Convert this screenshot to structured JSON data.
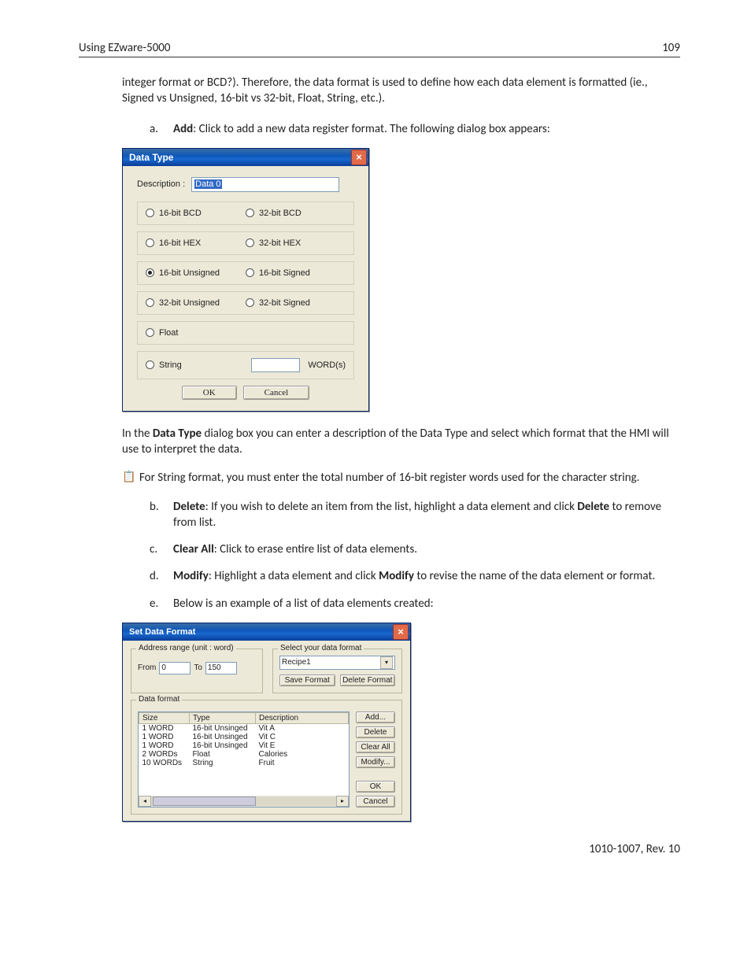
{
  "header": {
    "left": "Using EZware-5000",
    "right": "109"
  },
  "intro": "integer format or BCD?). Therefore, the data format is used to define how each data element is formatted (ie., Signed vs Unsigned, 16-bit vs 32-bit, Float, String, etc.).",
  "item_a": {
    "letter": "a.",
    "name": "Add",
    "rest": ": Click to add a new data register format. The following dialog box appears:"
  },
  "dlg1": {
    "title": "Data Type",
    "description_label": "Description :",
    "description_value": "Data 0",
    "radios": {
      "r16bcd": "16-bit BCD",
      "r32bcd": "32-bit BCD",
      "r16hex": "16-bit HEX",
      "r32hex": "32-bit HEX",
      "r16u": "16-bit Unsigned",
      "r16s": "16-bit Signed",
      "r32u": "32-bit Unsigned",
      "r32s": "32-bit Signed",
      "float": "Float",
      "string": "String",
      "words_suffix": "WORD(s)"
    },
    "ok": "OK",
    "cancel": "Cancel"
  },
  "after_dlg1_pre": "In the ",
  "after_dlg1_bold": "Data Type",
  "after_dlg1_post": " dialog box you can enter a description of the Data Type and select which format that the HMI will use to interpret the data.",
  "note": "For String format, you must enter the total number of 16-bit register words used for the character string.",
  "item_b": {
    "letter": "b.",
    "name": "Delete",
    "mid": ": If you wish to delete an item from the list, highlight a data element and click ",
    "name2": "Delete",
    "rest": " to remove from list."
  },
  "item_c": {
    "letter": "c.",
    "name": "Clear All",
    "rest": ": Click to erase entire list of data elements."
  },
  "item_d": {
    "letter": "d.",
    "name": "Modify",
    "mid": ": Highlight a data element and click ",
    "name2": "Modify",
    "rest": " to revise the name of the data element or format."
  },
  "item_e": {
    "letter": "e.",
    "rest": "Below is an example of a list of data elements created:"
  },
  "dlg2": {
    "title": "Set Data Format",
    "address_legend": "Address range (unit : word)",
    "from_label": "From",
    "from_value": "0",
    "to_label": "To",
    "to_value": "150",
    "select_legend": "Select your data format",
    "combo_value": "Recipe1",
    "save_format": "Save Format",
    "delete_format": "Delete Format",
    "data_format_legend": "Data format",
    "columns": {
      "size": "Size",
      "type": "Type",
      "desc": "Description"
    },
    "rows": [
      {
        "size": "1 WORD",
        "type": "16-bit Unsinged",
        "desc": "Vit A"
      },
      {
        "size": "1 WORD",
        "type": "16-bit Unsinged",
        "desc": "Vit C"
      },
      {
        "size": "1 WORD",
        "type": "16-bit Unsinged",
        "desc": "Vit E"
      },
      {
        "size": "2 WORDs",
        "type": "Float",
        "desc": "Calories"
      },
      {
        "size": "10 WORDs",
        "type": "String",
        "desc": "Fruit"
      }
    ],
    "buttons": {
      "add": "Add...",
      "delete": "Delete",
      "clear": "Clear All",
      "modify": "Modify...",
      "ok": "OK",
      "cancel": "Cancel"
    }
  },
  "footer": "1010-1007, Rev. 10"
}
